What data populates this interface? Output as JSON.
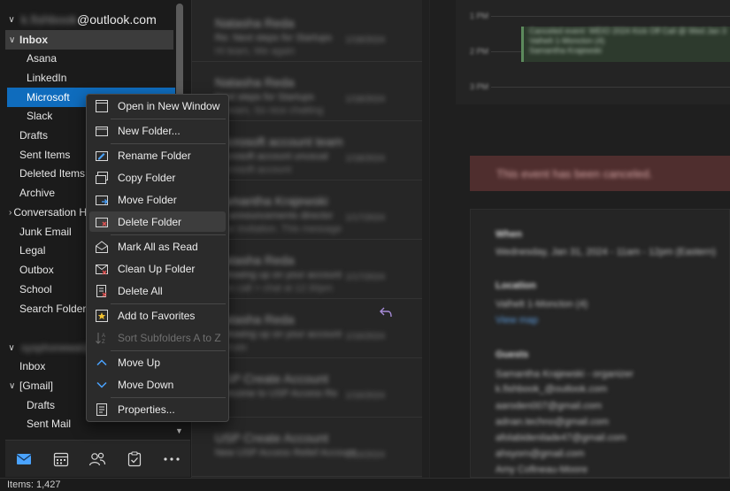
{
  "folder_pane": {
    "account1": {
      "name_blurred": "k.fishbook",
      "domain": "@outlook.com"
    },
    "inbox": {
      "label": "Inbox"
    },
    "subfolders": [
      {
        "label": "Asana"
      },
      {
        "label": "LinkedIn"
      },
      {
        "label": "Microsoft"
      },
      {
        "label": "Slack"
      }
    ],
    "folders": [
      {
        "label": "Drafts"
      },
      {
        "label": "Sent Items"
      },
      {
        "label": "Deleted Items"
      },
      {
        "label": "Archive"
      },
      {
        "label": "Conversation History"
      },
      {
        "label": "Junk Email"
      },
      {
        "label": "Legal"
      },
      {
        "label": "Outbox"
      },
      {
        "label": "School"
      },
      {
        "label": "Search Folders"
      }
    ],
    "account2": {
      "name_blurred": "sysphonewal@gmail.com"
    },
    "account2_folders": [
      {
        "label": "Inbox"
      },
      {
        "label": "[Gmail]"
      },
      {
        "label": "Drafts"
      },
      {
        "label": "Sent Mail"
      }
    ],
    "nav": [
      {
        "icon": "mail-icon"
      },
      {
        "icon": "calendar-icon"
      },
      {
        "icon": "people-icon"
      },
      {
        "icon": "tasks-icon"
      },
      {
        "icon": "more-icon"
      }
    ]
  },
  "context_menu": {
    "items": [
      {
        "label": "Open in New Window",
        "icon": "new-window-icon"
      },
      {
        "label": "New Folder...",
        "icon": "new-folder-icon"
      },
      {
        "label": "Rename Folder",
        "icon": "rename-folder-icon"
      },
      {
        "label": "Copy Folder",
        "icon": "copy-folder-icon"
      },
      {
        "label": "Move Folder",
        "icon": "move-folder-icon"
      },
      {
        "label": "Delete Folder",
        "icon": "delete-folder-icon"
      },
      {
        "label": "Mark All as Read",
        "icon": "mark-read-icon"
      },
      {
        "label": "Clean Up Folder",
        "icon": "clean-up-icon"
      },
      {
        "label": "Delete All",
        "icon": "delete-all-icon"
      },
      {
        "label": "Add to Favorites",
        "icon": "favorite-icon"
      },
      {
        "label": "Sort Subfolders A to Z",
        "icon": "sort-icon"
      },
      {
        "label": "Move Up",
        "icon": "move-up-icon"
      },
      {
        "label": "Move Down",
        "icon": "move-down-icon"
      },
      {
        "label": "Properties...",
        "icon": "properties-icon"
      }
    ]
  },
  "message_list": {
    "messages": [
      {
        "sender": "Natasha Reda",
        "subject": "Re: Next steps for Startups",
        "preview": "Hi team, We again",
        "date": "1/18/2024"
      },
      {
        "sender": "Natasha Reda",
        "subject": "Next steps for Startups",
        "preview": "Hi team, So nice chatting",
        "date": "1/18/2024"
      },
      {
        "sender": "Microsoft account team",
        "subject": "Microsoft account unusual",
        "preview": "Microsoft account",
        "date": "1/18/2024"
      },
      {
        "sender": "Samantha Krajewski",
        "subject": "All announcements director",
        "preview": "Your invitation. This message",
        "date": "1/17/2024"
      },
      {
        "sender": "Natasha Reda",
        "subject": "Following up on your account",
        "preview": "Intro call > chat at 12:30pm",
        "date": "1/17/2024"
      },
      {
        "sender": "Natasha Reda",
        "subject": "Following up on your account",
        "preview": "Hi Kate",
        "date": "1/16/2024"
      },
      {
        "sender": "USP Create Account",
        "subject": "Welcome to USP Access Re",
        "preview": "",
        "date": "1/16/2024"
      },
      {
        "sender": "USP Create Account",
        "subject": "New USP Access Relief Account",
        "preview": "",
        "date": "1/16/2024"
      }
    ]
  },
  "reading_pane": {
    "calendar": {
      "times": [
        "1 PM",
        "2 PM",
        "3 PM"
      ],
      "event": [
        "Canceled event: WEIO 2024 Kick Off Call @ Wed Jan 3",
        "Valhelt 1-Moncton (4)",
        "Samantha Krajewski"
      ]
    },
    "banner": "This event has been canceled.",
    "when_label": "When",
    "when_value": "Wednesday, Jan 31, 2024 - 11am - 12pm (Eastern)",
    "location_label": "Location",
    "location_value": "Valhelt 1-Moncton (4)",
    "view_map": "View map",
    "guests_label": "Guests",
    "guests": [
      "Samantha Krajewski - organizer",
      "k.fishbook_@outlook.com",
      "aaroden007@gmail.com",
      "adnan.techno@gmail.com",
      "afolabidenilade47@gmail.com",
      "ahsyorn@gmail.com",
      "Amy Cofineau-Moore"
    ]
  },
  "status_bar": {
    "items": "Items: 1,427"
  }
}
